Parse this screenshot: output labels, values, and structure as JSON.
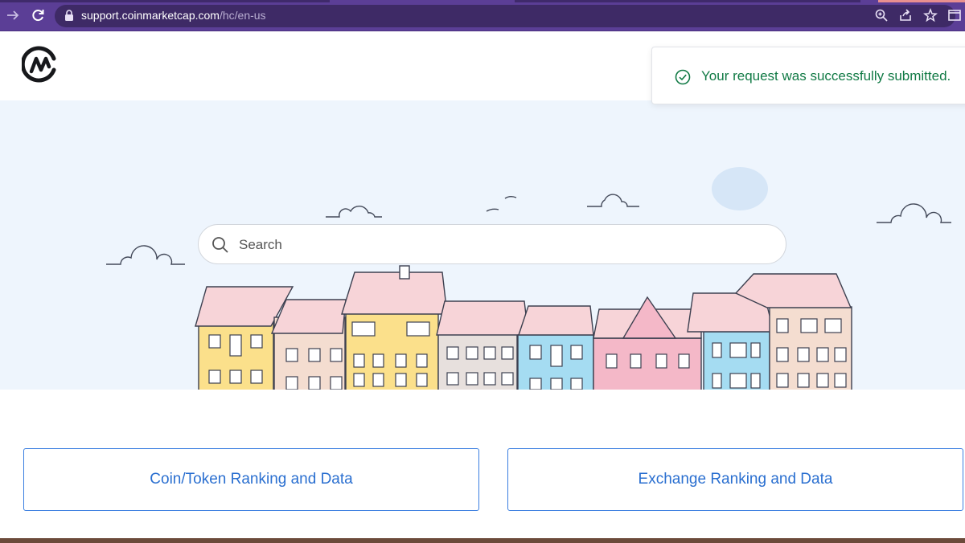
{
  "browser": {
    "url_host": "support.coinmarketcap.com",
    "url_path": "/hc/en-us",
    "icons": [
      "forward-icon",
      "reload-icon",
      "lock-icon",
      "zoom-icon",
      "share-icon",
      "bookmark-star-icon",
      "tab-layout-icon"
    ]
  },
  "header": {
    "logo": "coinmarketcap-logo"
  },
  "search": {
    "placeholder": "Search"
  },
  "toast": {
    "message": "Your request was successfully submitted.",
    "icon": "check-circle-icon",
    "color": "#117a45"
  },
  "categories": [
    {
      "label": "Coin/Token Ranking and Data"
    },
    {
      "label": "Exchange Ranking and Data"
    }
  ],
  "colors": {
    "browser_bar": "#5b3e96",
    "hero_bg": "#eef5fd",
    "accent": "#2a6fd0"
  }
}
